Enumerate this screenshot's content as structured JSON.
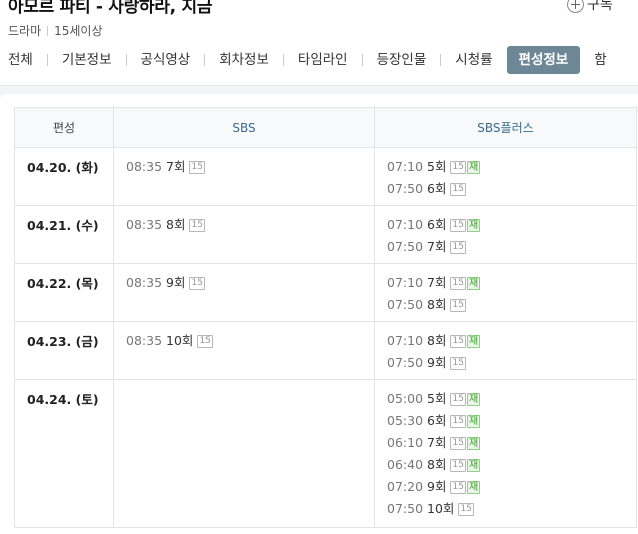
{
  "header": {
    "title": "아모르 파티 - 사랑하라, 지금",
    "subscribe_label": "구독",
    "genre": "드라마",
    "rating": "15세이상"
  },
  "tabs": [
    {
      "label": "전체"
    },
    {
      "label": "기본정보"
    },
    {
      "label": "공식영상"
    },
    {
      "label": "회차정보"
    },
    {
      "label": "타임라인"
    },
    {
      "label": "등장인물"
    },
    {
      "label": "시청률"
    },
    {
      "label": "편성정보"
    },
    {
      "label": "함"
    }
  ],
  "schedule": {
    "headers": {
      "date": "편성",
      "sbs": "SBS",
      "plus": "SBS플러스"
    },
    "age_badge": "15",
    "rerun_badge": "재",
    "rows": [
      {
        "date": "04.20. (화)",
        "sbs": [
          {
            "time": "08:35",
            "ep": "7회"
          }
        ],
        "plus": [
          {
            "time": "07:10",
            "ep": "5회",
            "rerun": true
          },
          {
            "time": "07:50",
            "ep": "6회",
            "rerun": false
          }
        ]
      },
      {
        "date": "04.21. (수)",
        "sbs": [
          {
            "time": "08:35",
            "ep": "8회"
          }
        ],
        "plus": [
          {
            "time": "07:10",
            "ep": "6회",
            "rerun": true
          },
          {
            "time": "07:50",
            "ep": "7회",
            "rerun": false
          }
        ]
      },
      {
        "date": "04.22. (목)",
        "sbs": [
          {
            "time": "08:35",
            "ep": "9회"
          }
        ],
        "plus": [
          {
            "time": "07:10",
            "ep": "7회",
            "rerun": true
          },
          {
            "time": "07:50",
            "ep": "8회",
            "rerun": false
          }
        ]
      },
      {
        "date": "04.23. (금)",
        "sbs": [
          {
            "time": "08:35",
            "ep": "10회"
          }
        ],
        "plus": [
          {
            "time": "07:10",
            "ep": "8회",
            "rerun": true
          },
          {
            "time": "07:50",
            "ep": "9회",
            "rerun": false
          }
        ]
      },
      {
        "date": "04.24. (토)",
        "sbs": [],
        "plus": [
          {
            "time": "05:00",
            "ep": "5회",
            "rerun": true
          },
          {
            "time": "05:30",
            "ep": "6회",
            "rerun": true
          },
          {
            "time": "06:10",
            "ep": "7회",
            "rerun": true
          },
          {
            "time": "06:40",
            "ep": "8회",
            "rerun": true
          },
          {
            "time": "07:20",
            "ep": "9회",
            "rerun": true
          },
          {
            "time": "07:50",
            "ep": "10회",
            "rerun": false
          }
        ]
      }
    ]
  }
}
